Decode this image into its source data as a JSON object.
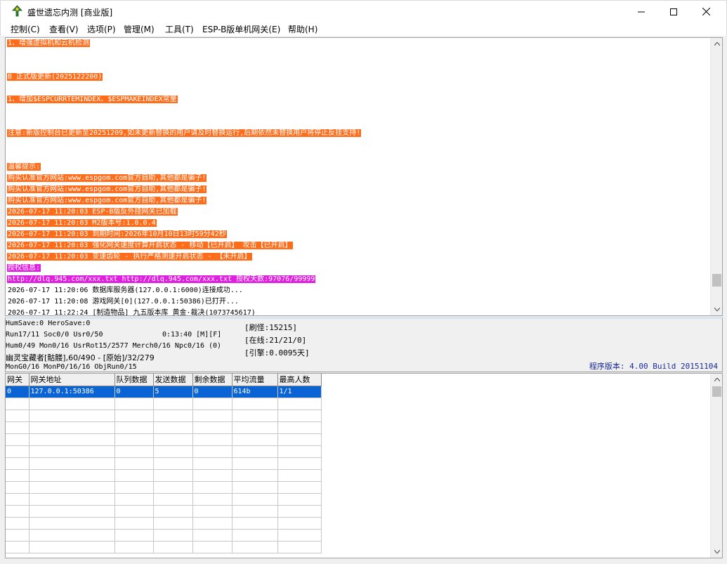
{
  "window": {
    "title": "盛世遗忘内测 [商业版]",
    "icon": "app-icon",
    "controls": {
      "minimize": "minimize-icon",
      "maximize": "maximize-icon",
      "close": "close-icon"
    }
  },
  "menu": [
    {
      "label": "控制(C)"
    },
    {
      "label": "查看(V)"
    },
    {
      "label": "选项(P)"
    },
    {
      "label": "管理(M)"
    },
    {
      "label": "工具(T)"
    },
    {
      "label": "ESP-B版单机网关(E)"
    },
    {
      "label": "帮助(H)"
    }
  ],
  "log": {
    "lines": [
      {
        "text": "1、增强虚拟机和云机检测",
        "style": "orange"
      },
      {
        "text": "",
        "style": "blank"
      },
      {
        "text": "",
        "style": "blank"
      },
      {
        "text": "B 正式版更新(2025122200)",
        "style": "orange"
      },
      {
        "text": "",
        "style": "blank"
      },
      {
        "text": "1、增加$ESPCURRTEMINDEX、$ESPMAKEINDEX常量",
        "style": "orange"
      },
      {
        "text": "",
        "style": "blank"
      },
      {
        "text": "",
        "style": "blank"
      },
      {
        "text": "注意:新版控制台已更新至20251209,如未更新替换的用户请及时替换运行,后期依然未替换用户将停止反挂支持!",
        "style": "orange"
      },
      {
        "text": "",
        "style": "blank"
      },
      {
        "text": "",
        "style": "blank"
      },
      {
        "text": "温馨提示:",
        "style": "orange"
      },
      {
        "text": "购买认准官方网站:www.espgom.com官方自助,其他都是骗子!",
        "style": "orange"
      },
      {
        "text": "购买认准官方网站:www.espgom.com官方自助,其他都是骗子!",
        "style": "orange"
      },
      {
        "text": "购买认准官方网站:www.espgom.com官方自助,其他都是骗子!",
        "style": "orange"
      },
      {
        "text": "2026-07-17 11:20:03 ESP-B版反外挂网关已加载",
        "style": "orange"
      },
      {
        "text": "2026-07-17 11:20:03 M2版本号:1.0.0.4",
        "style": "orange"
      },
      {
        "text": "2026-07-17 11:20:03 到期时间:2026年10月10日13时59分42秒",
        "style": "orange"
      },
      {
        "text": "2026-07-17 11:20:03 强化网关速度计算开启状态 - 移动【已开启】 攻击【已开启】",
        "style": "orange"
      },
      {
        "text": "2026-07-17 11:20:03 变速齿轮 - 执行严格测速开启状态 - 【未开启】",
        "style": "orange"
      },
      {
        "text": "授权信息:",
        "style": "magenta"
      },
      {
        "text": "http://dlq.945.com/xxx.txt http://dlq.945.com/xxx.txt 授权天数:97076/99999",
        "style": "magenta"
      },
      {
        "text": "2026-07-17 11:20:06 数据库服务器(127.0.0.1:6000)连接成功...",
        "style": "plain"
      },
      {
        "text": "2026-07-17 11:20:08 游戏网关[0](127.0.0.1:50386)已打开...",
        "style": "plain"
      },
      {
        "text": "2026-07-17 11:22:24 [制造物品] 九五版本库 黄金·裁决(1073745617)",
        "style": "plain"
      }
    ]
  },
  "status": {
    "line1": "HumSave:0 HeroSave:0",
    "line2a": "Run17/11 Soc0/0 Usr0/50",
    "line2b": "0:13:40 [M][F]",
    "line3": "Hum0/49 Mon0/16 UsrRot15/2577 Merch0/16 Npc0/16 (0)",
    "line4": "幽灵宝藏者[骷髅],60/490 - [原始]/32/279",
    "line5": "MonG0/16 MonP0/16/16 ObjRun0/15",
    "refresh": "[刷怪:15215]",
    "online": "[在线:21/21/0]",
    "engine": "[引擎:0.0095天]",
    "version": "程序版本: 4.00 Build 20151104"
  },
  "gateway_table": {
    "columns": [
      "网关",
      "网关地址",
      "队列数据",
      "发送数据",
      "剩余数据",
      "平均流量",
      "最高人数"
    ],
    "rows": [
      [
        "0",
        "127.0.0.1:50386",
        "0",
        "5",
        "0",
        "614b",
        "1/1"
      ]
    ],
    "selected_row": 0
  },
  "colors": {
    "highlight_orange": "#ff6c1a",
    "highlight_magenta": "#e020e0",
    "selection_blue": "#0a64d4",
    "version_text": "#1a2a9a"
  }
}
